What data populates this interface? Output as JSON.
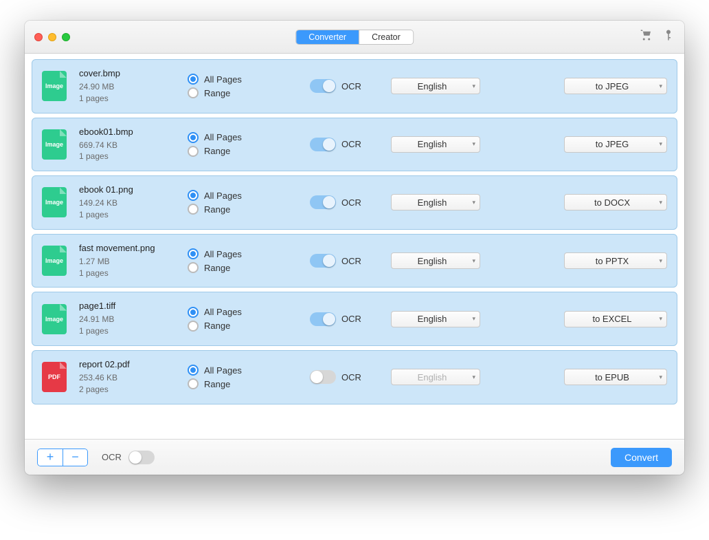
{
  "tabs": {
    "converter": "Converter",
    "creator": "Creator",
    "active": "converter"
  },
  "labels": {
    "all_pages": "All Pages",
    "range": "Range",
    "ocr": "OCR",
    "convert": "Convert",
    "add": "+",
    "remove": "−"
  },
  "footer": {
    "ocr": false
  },
  "files": [
    {
      "name": "cover.bmp",
      "size": "24.90 MB",
      "pages": "1 pages",
      "icon": "image",
      "page_option": "all",
      "ocr": true,
      "language": "English",
      "lang_disabled": false,
      "format": "to JPEG"
    },
    {
      "name": "ebook01.bmp",
      "size": "669.74 KB",
      "pages": "1 pages",
      "icon": "image",
      "page_option": "all",
      "ocr": true,
      "language": "English",
      "lang_disabled": false,
      "format": "to JPEG"
    },
    {
      "name": "ebook 01.png",
      "size": "149.24 KB",
      "pages": "1 pages",
      "icon": "image",
      "page_option": "all",
      "ocr": true,
      "language": "English",
      "lang_disabled": false,
      "format": "to DOCX"
    },
    {
      "name": "fast movement.png",
      "size": "1.27 MB",
      "pages": "1 pages",
      "icon": "image",
      "page_option": "all",
      "ocr": true,
      "language": "English",
      "lang_disabled": false,
      "format": "to PPTX"
    },
    {
      "name": "page1.tiff",
      "size": "24.91 MB",
      "pages": "1 pages",
      "icon": "image",
      "page_option": "all",
      "ocr": true,
      "language": "English",
      "lang_disabled": false,
      "format": "to EXCEL"
    },
    {
      "name": "report 02.pdf",
      "size": "253.46 KB",
      "pages": "2 pages",
      "icon": "pdf",
      "page_option": "all",
      "ocr": false,
      "language": "English",
      "lang_disabled": true,
      "format": "to EPUB"
    }
  ]
}
